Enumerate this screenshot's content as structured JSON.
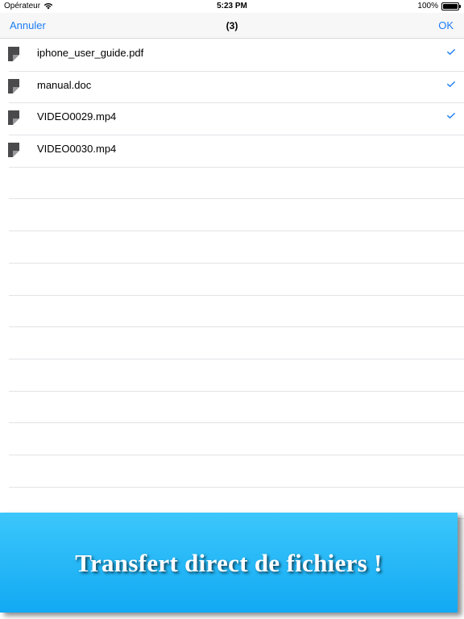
{
  "status_bar": {
    "carrier": "Opérateur",
    "wifi_icon": "wifi-icon",
    "time": "5:23 PM",
    "battery_text": "100%",
    "battery_level": 1.0
  },
  "nav": {
    "cancel_label": "Annuler",
    "title": "(3)",
    "ok_label": "OK",
    "accent_color": "#1a7cf5"
  },
  "files": [
    {
      "name": "iphone_user_guide.pdf",
      "icon": "document-icon",
      "selected": true
    },
    {
      "name": "manual.doc",
      "icon": "document-icon",
      "selected": true
    },
    {
      "name": "VIDEO0029.mp4",
      "icon": "document-icon",
      "selected": true
    },
    {
      "name": "VIDEO0030.mp4",
      "icon": "document-icon",
      "selected": false
    }
  ],
  "banner": {
    "text": "Transfert direct de fichiers !",
    "color": "#1fb4f6"
  }
}
